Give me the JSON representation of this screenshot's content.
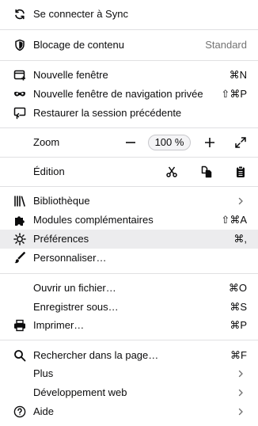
{
  "sync": {
    "label": "Se connecter à Sync",
    "icon": "sync-icon"
  },
  "content_blocking": {
    "label": "Blocage de contenu",
    "value": "Standard",
    "icon": "shield-icon"
  },
  "new_window": {
    "label": "Nouvelle fenêtre",
    "shortcut": "⌘N",
    "icon": "new-window-icon"
  },
  "private_window": {
    "label": "Nouvelle fenêtre de navigation privée",
    "shortcut": "⇧⌘P",
    "icon": "mask-icon"
  },
  "restore_session": {
    "label": "Restaurer la session précédente",
    "icon": "restore-session-icon"
  },
  "zoom": {
    "label": "Zoom",
    "minus": "−",
    "value": "100 %",
    "plus": "+",
    "icon": "fullscreen-icon"
  },
  "edit": {
    "label": "Édition",
    "cut_icon": "scissors-icon",
    "copy_icon": "copy-icon",
    "paste_icon": "clipboard-icon"
  },
  "library": {
    "label": "Bibliothèque",
    "icon": "library-icon"
  },
  "addons": {
    "label": "Modules complémentaires",
    "shortcut": "⇧⌘A",
    "icon": "puzzle-icon"
  },
  "preferences": {
    "label": "Préférences",
    "shortcut": "⌘,",
    "icon": "gear-icon"
  },
  "customize": {
    "label": "Personnaliser…",
    "icon": "paintbrush-icon"
  },
  "open_file": {
    "label": "Ouvrir un fichier…",
    "shortcut": "⌘O"
  },
  "save_as": {
    "label": "Enregistrer sous…",
    "shortcut": "⌘S"
  },
  "print": {
    "label": "Imprimer…",
    "shortcut": "⌘P",
    "icon": "printer-icon"
  },
  "find": {
    "label": "Rechercher dans la page…",
    "shortcut": "⌘F",
    "icon": "search-icon"
  },
  "more": {
    "label": "Plus"
  },
  "web_dev": {
    "label": "Développement web"
  },
  "help": {
    "label": "Aide",
    "icon": "help-icon"
  },
  "colors": {
    "separator": "#e0e0e2",
    "hover": "#ececee",
    "muted": "#737373"
  }
}
